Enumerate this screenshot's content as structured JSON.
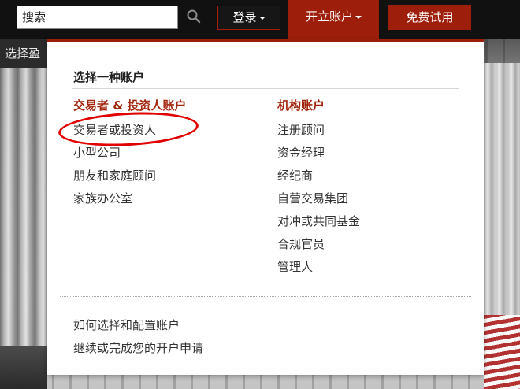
{
  "topbar": {
    "search_value": "搜索",
    "login_label": "登录",
    "open_account_label": "开立账户",
    "free_trial_label": "免费试用"
  },
  "subnav": {
    "text": "选择盈"
  },
  "dropdown": {
    "title": "选择一种账户",
    "left_column": {
      "heading": "交易者 & 投资人账户",
      "items": [
        "交易者或投资人",
        "小型公司",
        "朋友和家庭顾问",
        "家族办公室"
      ]
    },
    "right_column": {
      "heading": "机构账户",
      "items": [
        "注册顾问",
        "资金经理",
        "经纪商",
        "自营交易集团",
        "对冲或共同基金",
        "合规官员",
        "管理人"
      ]
    },
    "footer_links": [
      "如何选择和配置账户",
      "继续或完成您的开户申请"
    ]
  },
  "icons": {
    "search": "search-icon",
    "caret": "caret-down-icon"
  },
  "colors": {
    "accent": "#9d1f0b",
    "heading_red": "#a2270f",
    "annotation": "#e00000"
  }
}
